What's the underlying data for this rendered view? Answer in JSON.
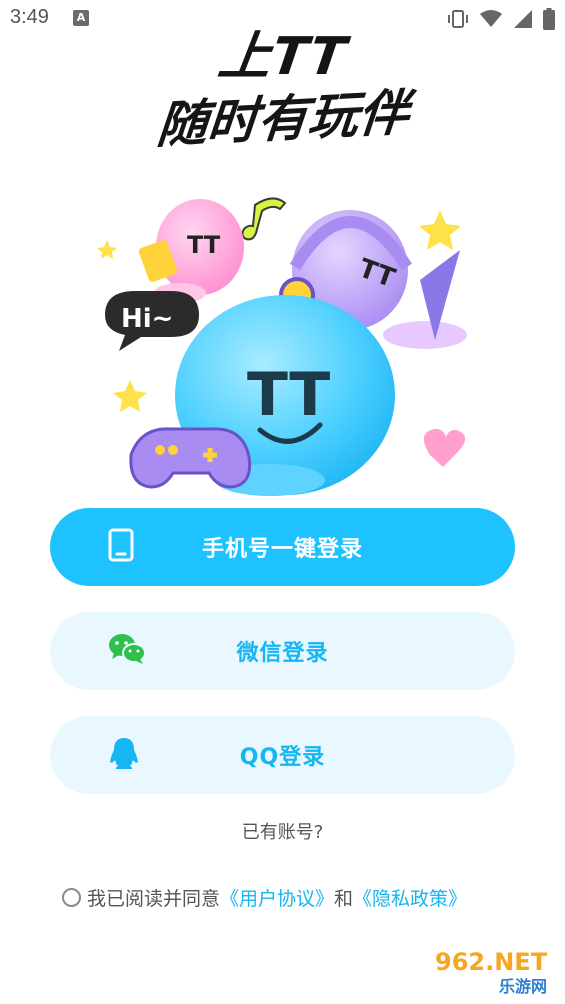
{
  "status_bar": {
    "time": "3:49",
    "notification_icon": "A"
  },
  "headline": {
    "line1": "上TT",
    "line2": "随时有玩伴"
  },
  "illustration": {
    "speech_bubble": "Hi~",
    "blue_face": "TT",
    "pink_face": "TT",
    "purple_face": "TT"
  },
  "buttons": {
    "phone_login": "手机号一键登录",
    "wechat_login": "微信登录",
    "qq_login": "QQ登录"
  },
  "have_account": "已有账号?",
  "agreement": {
    "prefix": "我已阅读并同意",
    "user_agreement": "《用户协议》",
    "and": "和",
    "privacy_policy": "《隐私政策》"
  },
  "watermark": {
    "brand": "962.NET",
    "sub": "乐游网"
  },
  "colors": {
    "primary": "#1ec2ff",
    "secondary_bg": "#e9f8ff",
    "link": "#16b5f3"
  }
}
